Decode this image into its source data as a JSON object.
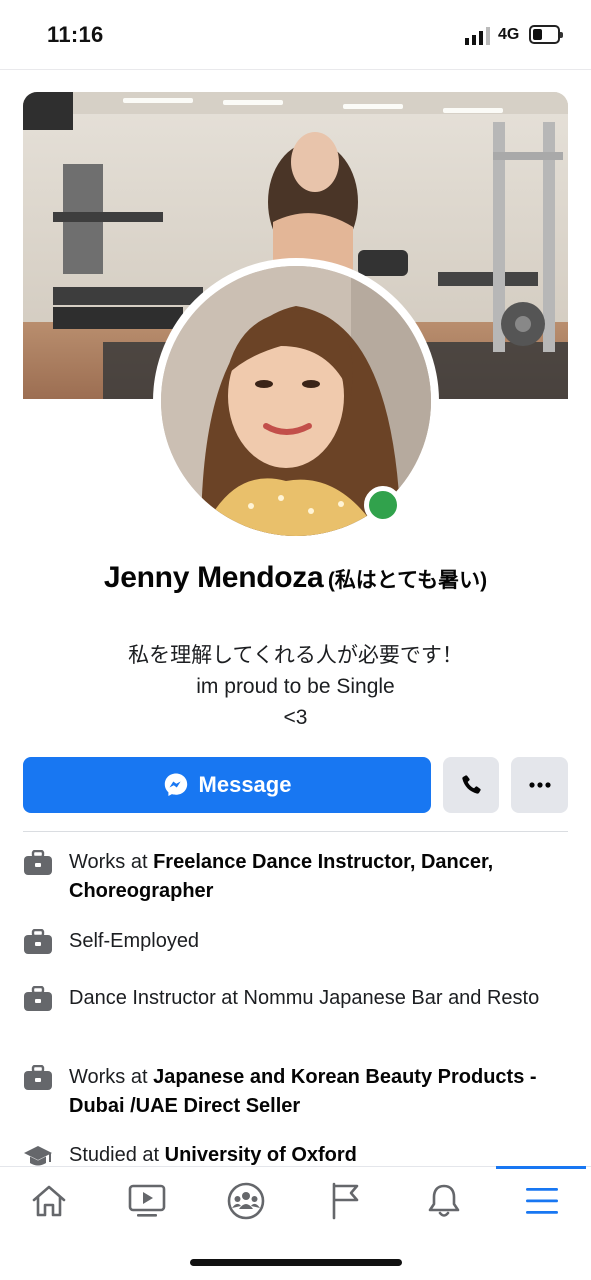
{
  "status_bar": {
    "time": "11:16",
    "network": "4G",
    "battery_level": 0.3,
    "icons": [
      "signal-icon",
      "battery-icon"
    ]
  },
  "profile": {
    "name": "Jenny Mendoza",
    "alternate_name": "(私はとても暑い)",
    "bio": [
      "私を理解してくれる人が必要です！",
      "im proud to be Single",
      "<3"
    ],
    "online": true,
    "online_color": "#31a24c"
  },
  "actions": {
    "message_label": "Message",
    "message_icon": "messenger-icon",
    "call_icon": "phone-icon",
    "more_icon": "more-icon"
  },
  "info": [
    {
      "icon": "briefcase-icon",
      "prefix": "Works at ",
      "bold": "Freelance Dance Instructor, Dancer, Choreographer"
    },
    {
      "icon": "briefcase-icon",
      "prefix": "Self-Employed",
      "bold": ""
    },
    {
      "icon": "briefcase-icon",
      "prefix": "Dance Instructor at Nommu Japanese Bar and Resto",
      "bold": ""
    },
    {
      "icon": "briefcase-icon",
      "prefix": "Works at ",
      "bold": "Japanese and Korean Beauty Products - Dubai /UAE Direct Seller"
    },
    {
      "icon": "graduation-cap-icon",
      "prefix": "Studied at ",
      "bold": "University of Oxford"
    }
  ],
  "bottom_nav": {
    "items": [
      "home-icon",
      "watch-icon",
      "groups-icon",
      "pages-flag-icon",
      "notifications-bell-icon",
      "menu-icon"
    ],
    "active": "menu-icon"
  },
  "colors": {
    "accent": "#1877f2",
    "button_gray": "#e4e6eb",
    "icon_gray": "#65676b"
  }
}
